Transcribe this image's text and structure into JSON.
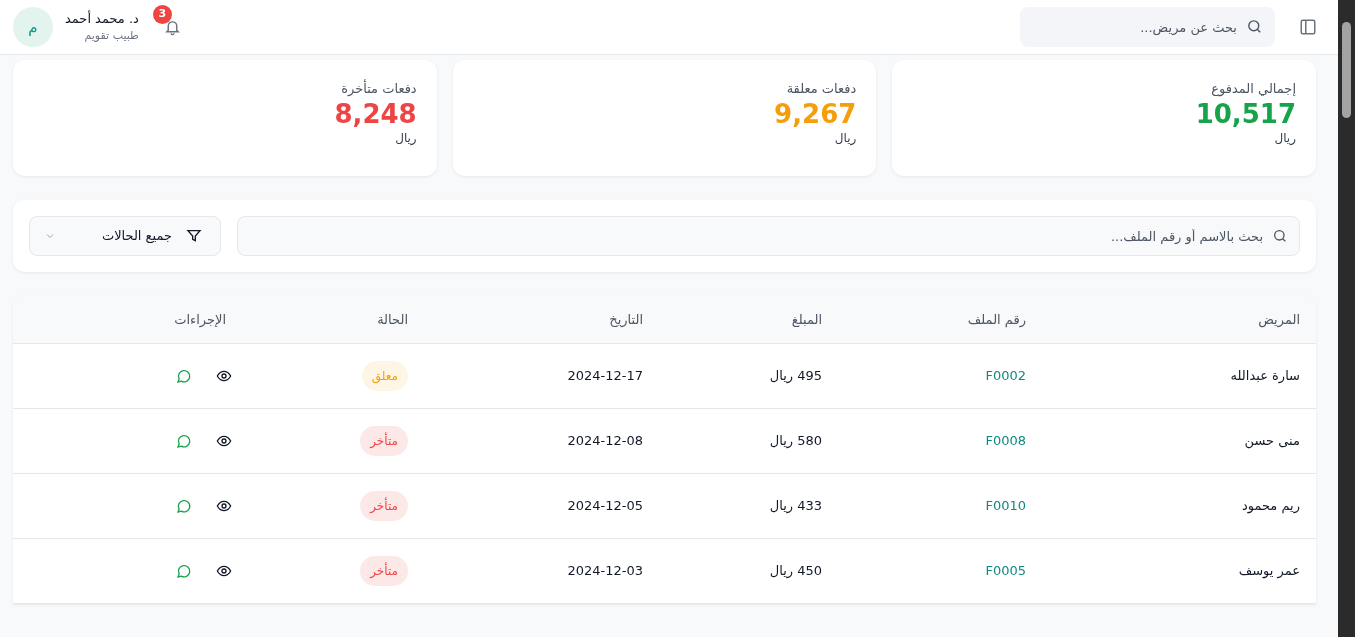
{
  "header": {
    "search": {
      "placeholder": "بحث عن مريض..."
    },
    "user": {
      "avatar_letter": "م",
      "name": "د. محمد أحمد",
      "role": "طبيب تقويم"
    },
    "notifications": {
      "count": "3"
    }
  },
  "stats": [
    {
      "kind": "paid",
      "label": "إجمالي المدفوع",
      "value": "10,517",
      "unit": "ريال"
    },
    {
      "kind": "pending",
      "label": "دفعات معلقة",
      "value": "9,267",
      "unit": "ريال"
    },
    {
      "kind": "late",
      "label": "دفعات متأخرة",
      "value": "8,248",
      "unit": "ريال"
    }
  ],
  "filters": {
    "search": {
      "placeholder": "بحث بالاسم أو رقم الملف..."
    },
    "status_select": {
      "value": "جميع الحالات"
    }
  },
  "table": {
    "columns": [
      "المريض",
      "رقم الملف",
      "المبلغ",
      "التاريخ",
      "الحالة",
      "الإجراءات"
    ],
    "rows": [
      {
        "patient": "سارة عبدالله",
        "file": "F0002",
        "amount": "495 ريال",
        "date": "2024-12-17",
        "status": {
          "kind": "pending",
          "label": "معلق"
        }
      },
      {
        "patient": "منى حسن",
        "file": "F0008",
        "amount": "580 ريال",
        "date": "2024-12-08",
        "status": {
          "kind": "late",
          "label": "متأخر"
        }
      },
      {
        "patient": "ريم محمود",
        "file": "F0010",
        "amount": "433 ريال",
        "date": "2024-12-05",
        "status": {
          "kind": "late",
          "label": "متأخر"
        }
      },
      {
        "patient": "عمر يوسف",
        "file": "F0005",
        "amount": "450 ريال",
        "date": "2024-12-03",
        "status": {
          "kind": "late",
          "label": "متأخر"
        }
      }
    ]
  }
}
